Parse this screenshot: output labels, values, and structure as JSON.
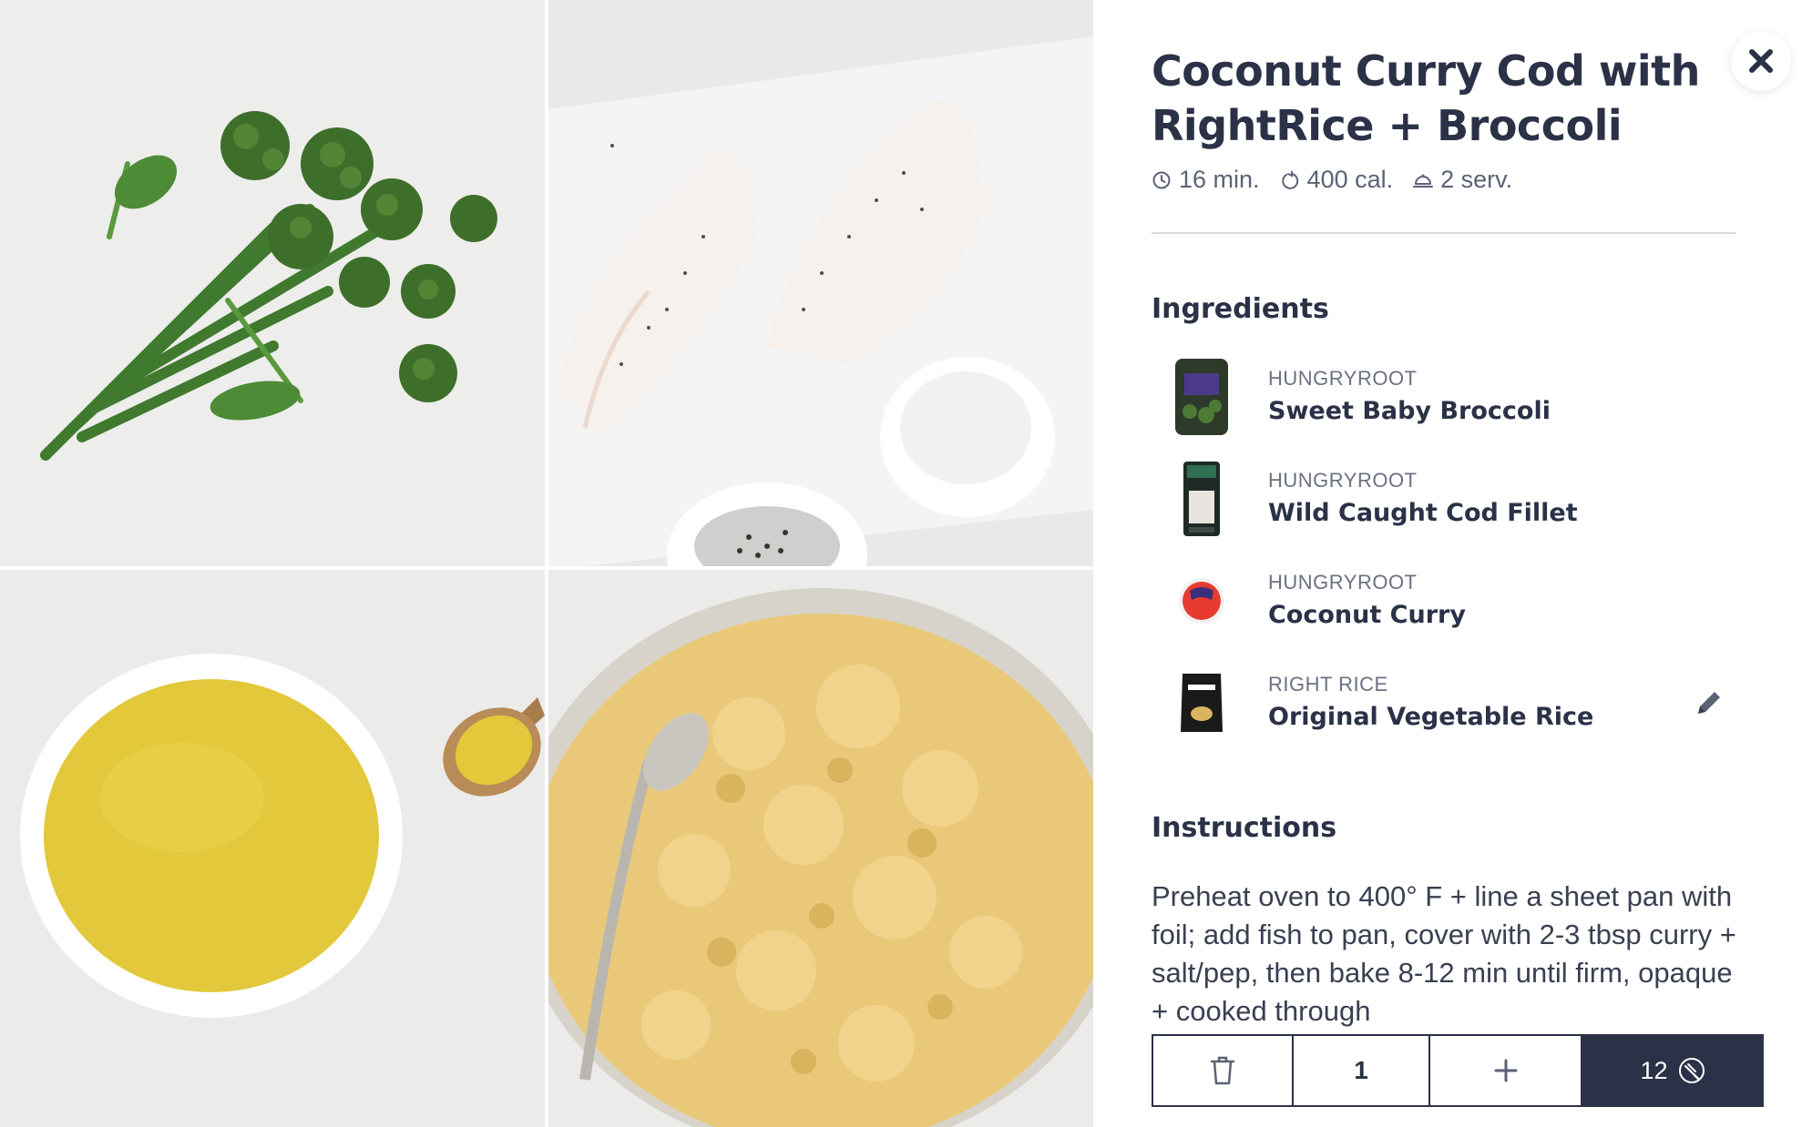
{
  "recipe": {
    "title": "Coconut Curry Cod with RightRice + Broccoli",
    "meta": {
      "time": "16 min.",
      "calories": "400 cal.",
      "servings": "2 serv."
    }
  },
  "ingredients": {
    "heading": "Ingredients",
    "items": [
      {
        "brand": "HUNGRYROOT",
        "name": "Sweet Baby Broccoli",
        "icon": "broccoli-package-thumb"
      },
      {
        "brand": "HUNGRYROOT",
        "name": "Wild Caught Cod Fillet",
        "icon": "cod-package-thumb"
      },
      {
        "brand": "HUNGRYROOT",
        "name": "Coconut Curry",
        "icon": "curry-jar-thumb"
      },
      {
        "brand": "RIGHT RICE",
        "name": "Original Vegetable Rice",
        "icon": "rice-bag-thumb"
      }
    ]
  },
  "instructions": {
    "heading": "Instructions",
    "text": "Preheat oven to 400° F + line a sheet pan with foil; add fish to pan, cover with 2-3 tbsp curry + salt/pep, then bake 8-12 min until firm, opaque + cooked through"
  },
  "action_bar": {
    "quantity": "1",
    "points": "12"
  },
  "colors": {
    "navy": "#2b3147",
    "muted": "#6b7183",
    "divider": "#d9dbe1"
  }
}
